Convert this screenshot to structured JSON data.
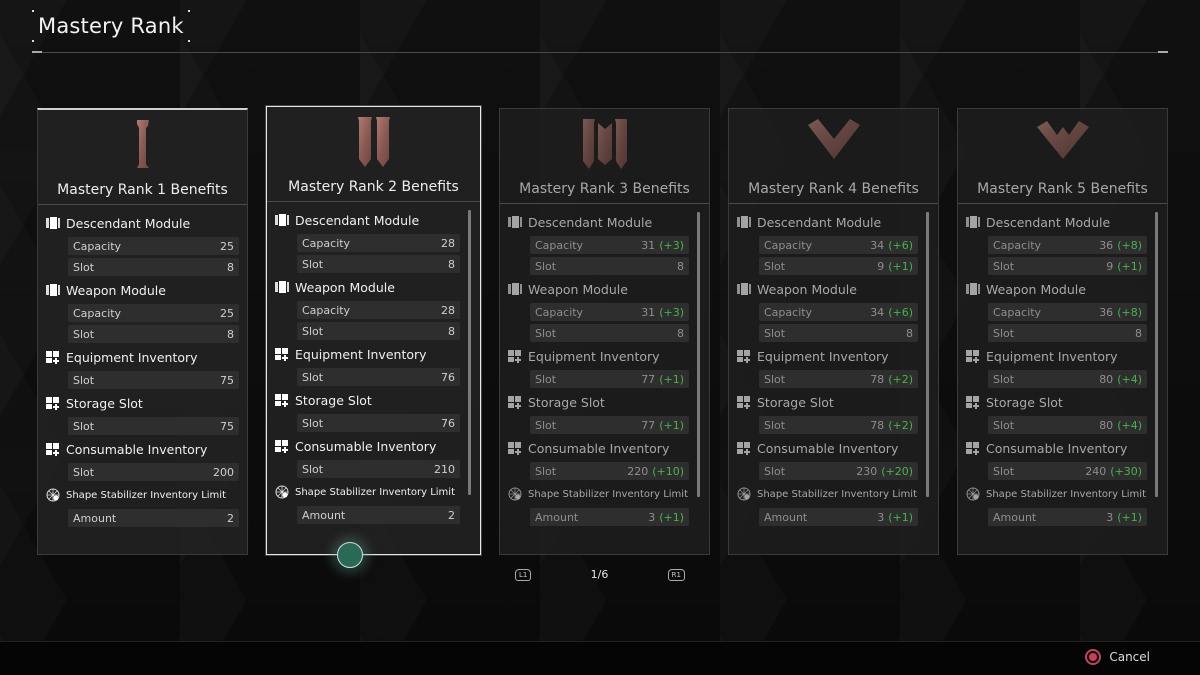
{
  "header": {
    "title": "Mastery Rank"
  },
  "cards": [
    {
      "title": "Mastery Rank 1 Benefits",
      "emblem": "rank-1-emblem",
      "groups": [
        {
          "label": "Descendant Module",
          "icon": "module-icon",
          "rows": [
            {
              "label": "Capacity",
              "value": "25",
              "delta": ""
            },
            {
              "label": "Slot",
              "value": "8",
              "delta": ""
            }
          ]
        },
        {
          "label": "Weapon Module",
          "icon": "module-icon",
          "rows": [
            {
              "label": "Capacity",
              "value": "25",
              "delta": ""
            },
            {
              "label": "Slot",
              "value": "8",
              "delta": ""
            }
          ]
        },
        {
          "label": "Equipment Inventory",
          "icon": "inventory-plus-icon",
          "rows": [
            {
              "label": "Slot",
              "value": "75",
              "delta": ""
            }
          ]
        },
        {
          "label": "Storage Slot",
          "icon": "inventory-plus-icon",
          "rows": [
            {
              "label": "Slot",
              "value": "75",
              "delta": ""
            }
          ]
        },
        {
          "label": "Consumable Inventory",
          "icon": "inventory-plus-icon",
          "rows": [
            {
              "label": "Slot",
              "value": "200",
              "delta": ""
            }
          ]
        },
        {
          "label": "Shape Stabilizer Inventory Limit",
          "icon": "stabilizer-icon",
          "rows": [
            {
              "label": "Amount",
              "value": "2",
              "delta": ""
            }
          ]
        }
      ]
    },
    {
      "title": "Mastery Rank 2 Benefits",
      "emblem": "rank-2-emblem",
      "groups": [
        {
          "label": "Descendant Module",
          "icon": "module-icon",
          "rows": [
            {
              "label": "Capacity",
              "value": "28",
              "delta": ""
            },
            {
              "label": "Slot",
              "value": "8",
              "delta": ""
            }
          ]
        },
        {
          "label": "Weapon Module",
          "icon": "module-icon",
          "rows": [
            {
              "label": "Capacity",
              "value": "28",
              "delta": ""
            },
            {
              "label": "Slot",
              "value": "8",
              "delta": ""
            }
          ]
        },
        {
          "label": "Equipment Inventory",
          "icon": "inventory-plus-icon",
          "rows": [
            {
              "label": "Slot",
              "value": "76",
              "delta": ""
            }
          ]
        },
        {
          "label": "Storage Slot",
          "icon": "inventory-plus-icon",
          "rows": [
            {
              "label": "Slot",
              "value": "76",
              "delta": ""
            }
          ]
        },
        {
          "label": "Consumable Inventory",
          "icon": "inventory-plus-icon",
          "rows": [
            {
              "label": "Slot",
              "value": "210",
              "delta": ""
            }
          ]
        },
        {
          "label": "Shape Stabilizer Inventory Limit",
          "icon": "stabilizer-icon",
          "rows": [
            {
              "label": "Amount",
              "value": "2",
              "delta": ""
            }
          ]
        }
      ]
    },
    {
      "title": "Mastery Rank 3 Benefits",
      "emblem": "rank-3-emblem",
      "groups": [
        {
          "label": "Descendant Module",
          "icon": "module-icon",
          "rows": [
            {
              "label": "Capacity",
              "value": "31",
              "delta": "(+3)"
            },
            {
              "label": "Slot",
              "value": "8",
              "delta": ""
            }
          ]
        },
        {
          "label": "Weapon Module",
          "icon": "module-icon",
          "rows": [
            {
              "label": "Capacity",
              "value": "31",
              "delta": "(+3)"
            },
            {
              "label": "Slot",
              "value": "8",
              "delta": ""
            }
          ]
        },
        {
          "label": "Equipment Inventory",
          "icon": "inventory-plus-icon",
          "rows": [
            {
              "label": "Slot",
              "value": "77",
              "delta": "(+1)"
            }
          ]
        },
        {
          "label": "Storage Slot",
          "icon": "inventory-plus-icon",
          "rows": [
            {
              "label": "Slot",
              "value": "77",
              "delta": "(+1)"
            }
          ]
        },
        {
          "label": "Consumable Inventory",
          "icon": "inventory-plus-icon",
          "rows": [
            {
              "label": "Slot",
              "value": "220",
              "delta": "(+10)"
            }
          ]
        },
        {
          "label": "Shape Stabilizer Inventory Limit",
          "icon": "stabilizer-icon",
          "rows": [
            {
              "label": "Amount",
              "value": "3",
              "delta": "(+1)"
            }
          ]
        }
      ]
    },
    {
      "title": "Mastery Rank 4 Benefits",
      "emblem": "rank-4-emblem",
      "groups": [
        {
          "label": "Descendant Module",
          "icon": "module-icon",
          "rows": [
            {
              "label": "Capacity",
              "value": "34",
              "delta": "(+6)"
            },
            {
              "label": "Slot",
              "value": "9",
              "delta": "(+1)"
            }
          ]
        },
        {
          "label": "Weapon Module",
          "icon": "module-icon",
          "rows": [
            {
              "label": "Capacity",
              "value": "34",
              "delta": "(+6)"
            },
            {
              "label": "Slot",
              "value": "8",
              "delta": ""
            }
          ]
        },
        {
          "label": "Equipment Inventory",
          "icon": "inventory-plus-icon",
          "rows": [
            {
              "label": "Slot",
              "value": "78",
              "delta": "(+2)"
            }
          ]
        },
        {
          "label": "Storage Slot",
          "icon": "inventory-plus-icon",
          "rows": [
            {
              "label": "Slot",
              "value": "78",
              "delta": "(+2)"
            }
          ]
        },
        {
          "label": "Consumable Inventory",
          "icon": "inventory-plus-icon",
          "rows": [
            {
              "label": "Slot",
              "value": "230",
              "delta": "(+20)"
            }
          ]
        },
        {
          "label": "Shape Stabilizer Inventory Limit",
          "icon": "stabilizer-icon",
          "rows": [
            {
              "label": "Amount",
              "value": "3",
              "delta": "(+1)"
            }
          ]
        }
      ]
    },
    {
      "title": "Mastery Rank 5 Benefits",
      "emblem": "rank-5-emblem",
      "groups": [
        {
          "label": "Descendant Module",
          "icon": "module-icon",
          "rows": [
            {
              "label": "Capacity",
              "value": "36",
              "delta": "(+8)"
            },
            {
              "label": "Slot",
              "value": "9",
              "delta": "(+1)"
            }
          ]
        },
        {
          "label": "Weapon Module",
          "icon": "module-icon",
          "rows": [
            {
              "label": "Capacity",
              "value": "36",
              "delta": "(+8)"
            },
            {
              "label": "Slot",
              "value": "8",
              "delta": ""
            }
          ]
        },
        {
          "label": "Equipment Inventory",
          "icon": "inventory-plus-icon",
          "rows": [
            {
              "label": "Slot",
              "value": "80",
              "delta": "(+4)"
            }
          ]
        },
        {
          "label": "Storage Slot",
          "icon": "inventory-plus-icon",
          "rows": [
            {
              "label": "Slot",
              "value": "80",
              "delta": "(+4)"
            }
          ]
        },
        {
          "label": "Consumable Inventory",
          "icon": "inventory-plus-icon",
          "rows": [
            {
              "label": "Slot",
              "value": "240",
              "delta": "(+30)"
            }
          ]
        },
        {
          "label": "Shape Stabilizer Inventory Limit",
          "icon": "stabilizer-icon",
          "rows": [
            {
              "label": "Amount",
              "value": "3",
              "delta": "(+1)"
            }
          ]
        }
      ]
    }
  ],
  "pager": {
    "prev_button": "L1",
    "next_button": "R1",
    "page": "1/6"
  },
  "footer": {
    "cancel_label": "Cancel"
  },
  "colors": {
    "delta_green": "#4caf50",
    "emblem_copper": "#9a6a62",
    "cancel_red": "#d33b5b",
    "cursor_teal": "#2a6a55"
  }
}
